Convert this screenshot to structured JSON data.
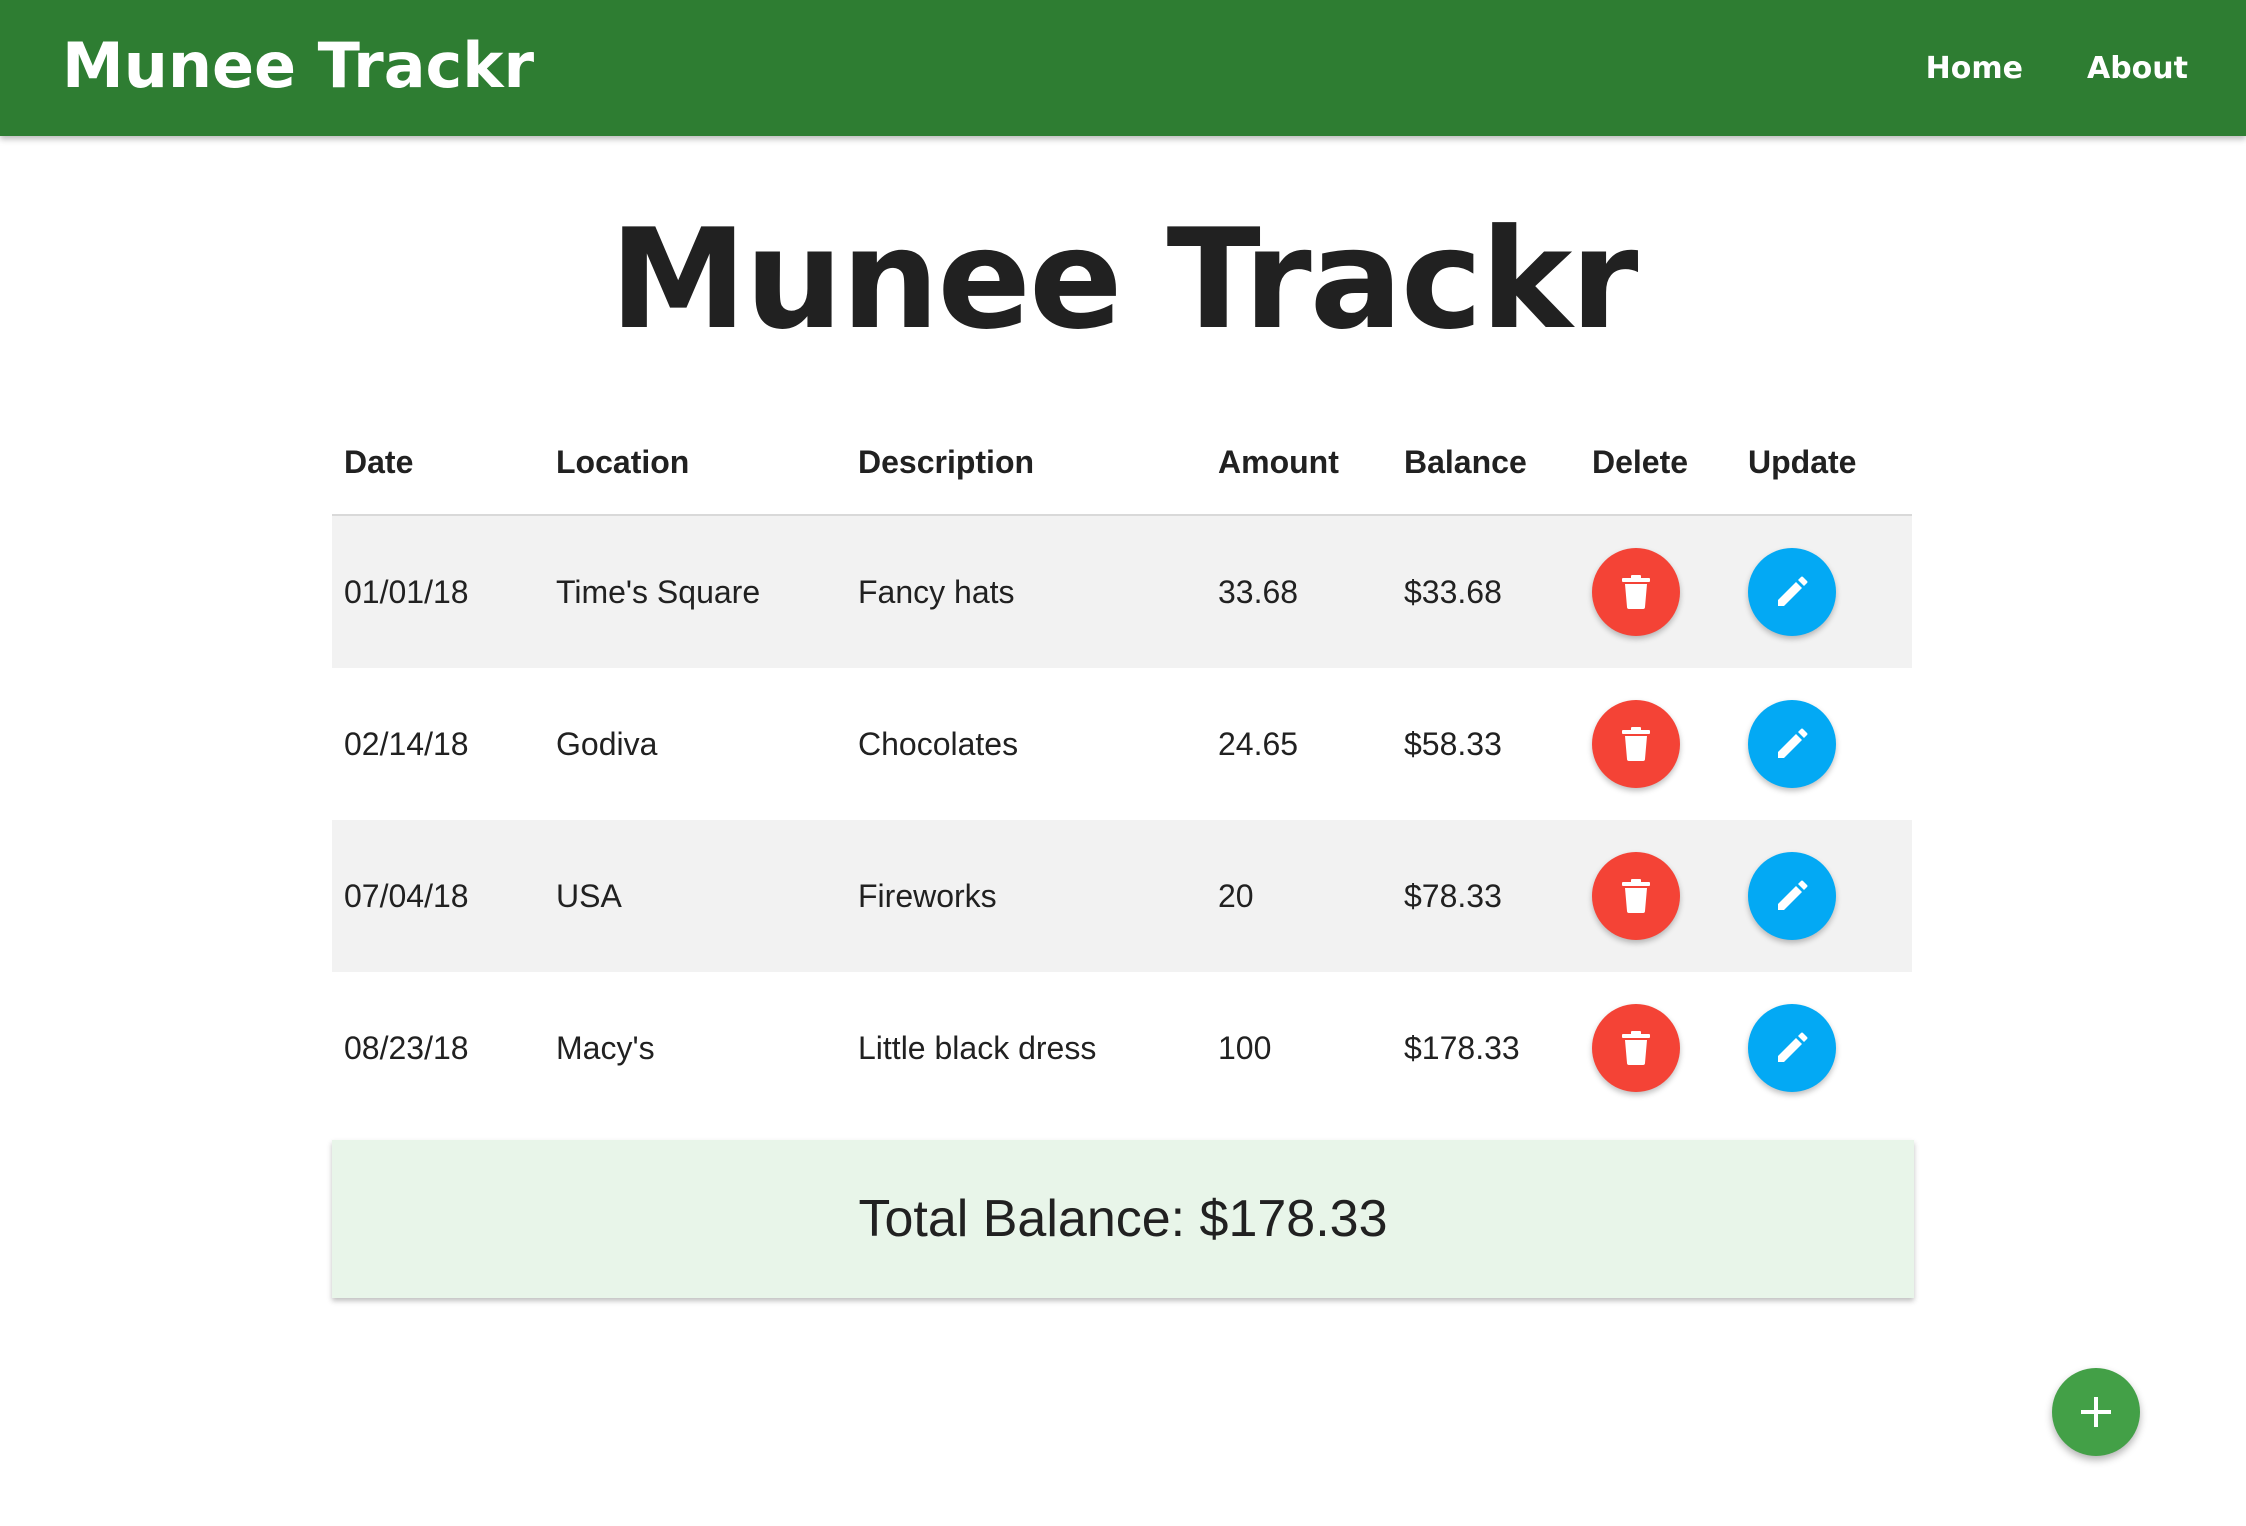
{
  "navbar": {
    "brand": "Munee Trackr",
    "links": [
      "Home",
      "About"
    ],
    "color": "#2e7d32"
  },
  "page_title": "Munee Trackr",
  "table": {
    "headers": [
      "Date",
      "Location",
      "Description",
      "Amount",
      "Balance",
      "Delete",
      "Update"
    ],
    "rows": [
      {
        "date": "01/01/18",
        "location": "Time's Square",
        "description": "Fancy hats",
        "amount": "33.68",
        "balance": "$33.68"
      },
      {
        "date": "02/14/18",
        "location": "Godiva",
        "description": "Chocolates",
        "amount": "24.65",
        "balance": "$58.33"
      },
      {
        "date": "07/04/18",
        "location": "USA",
        "description": "Fireworks",
        "amount": "20",
        "balance": "$78.33"
      },
      {
        "date": "08/23/18",
        "location": "Macy's",
        "description": "Little black dress",
        "amount": "100",
        "balance": "$178.33"
      }
    ],
    "delete_icon": "trash-icon",
    "update_icon": "pencil-icon"
  },
  "total": {
    "text": "Total Balance: $178.33"
  },
  "add_button": {
    "icon": "plus-icon",
    "color": "#43a047"
  },
  "colors": {
    "delete": "#f44336",
    "update": "#03a9f4",
    "total_background": "#e8f5e9"
  }
}
